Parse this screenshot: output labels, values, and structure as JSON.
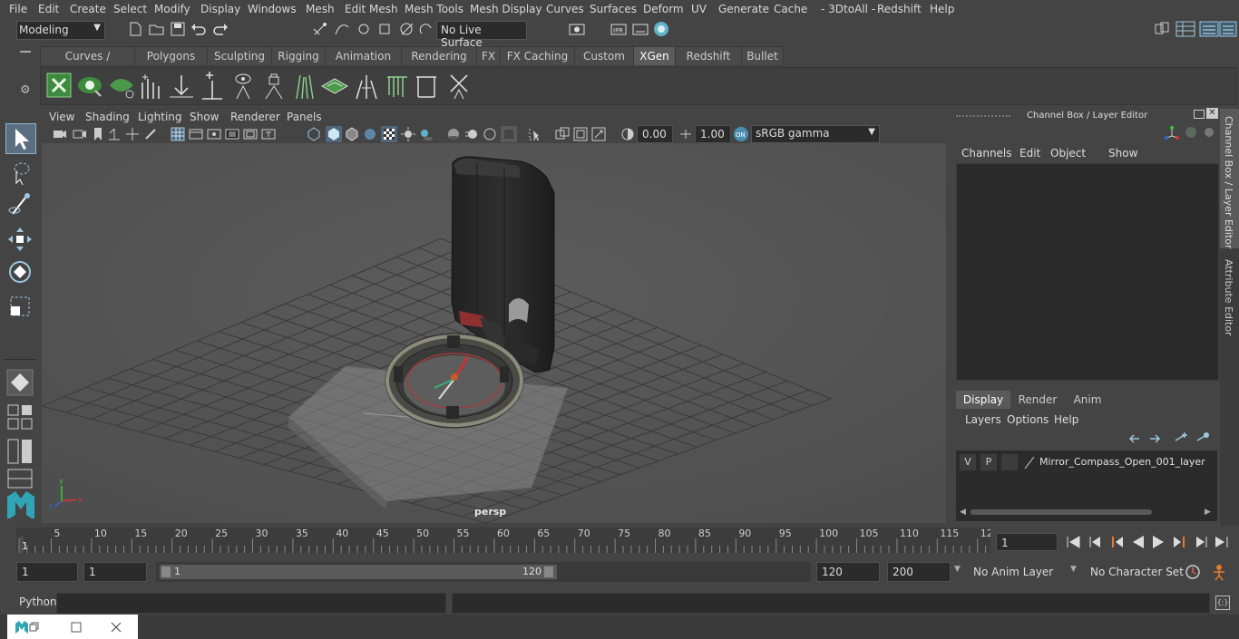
{
  "menu": [
    "File",
    "Edit",
    "Create",
    "Select",
    "Modify",
    "Display",
    "Windows",
    "Mesh",
    "Edit Mesh",
    "Mesh Tools",
    "Mesh Display",
    "Curves",
    "Surfaces",
    "Deform",
    "UV",
    "Generate",
    "Cache",
    "- 3DtoAll -",
    "Redshift",
    "Help"
  ],
  "status": {
    "mode": "Modeling",
    "live_surface": "No Live Surface"
  },
  "shelf_tabs": [
    "Curves / Surfaces",
    "Polygons",
    "Sculpting",
    "Rigging",
    "Animation",
    "Rendering",
    "FX",
    "FX Caching",
    "Custom",
    "XGen",
    "Redshift",
    "Bullet"
  ],
  "active_shelf": "XGen",
  "viewport": {
    "menu": [
      "View",
      "Shading",
      "Lighting",
      "Show",
      "Renderer",
      "Panels"
    ],
    "exposure": "0.00",
    "gamma": "1.00",
    "color_space": "sRGB gamma",
    "camera_label": "persp"
  },
  "channel_box": {
    "title": "Channel Box / Layer Editor",
    "menu": [
      "Channels",
      "Edit",
      "Object",
      "Show"
    ],
    "layer_tabs": [
      "Display",
      "Render",
      "Anim"
    ],
    "active_layer_tab": "Display",
    "layer_menu": [
      "Layers",
      "Options",
      "Help"
    ],
    "layer": {
      "v": "V",
      "p": "P",
      "name": "Mirror_Compass_Open_001_layer"
    }
  },
  "side_tabs": [
    "Channel Box / Layer Editor",
    "Attribute Editor"
  ],
  "timeline": {
    "ticks": [
      "5",
      "10",
      "15",
      "20",
      "25",
      "30",
      "35",
      "40",
      "45",
      "50",
      "55",
      "60",
      "65",
      "70",
      "75",
      "80",
      "85",
      "90",
      "95",
      "100",
      "105",
      "110",
      "115",
      "12"
    ],
    "start_label": "1",
    "current_frame": "1"
  },
  "range": {
    "start": "1",
    "current": "1",
    "slider_start": "1",
    "slider_end": "120",
    "end": "120",
    "max": "200",
    "anim_layer": "No Anim Layer",
    "character_set": "No Character Set"
  },
  "cmd": {
    "label": "Python"
  },
  "colors": {
    "accent": "#5fb4c9",
    "layer_bg": "#2b2b2b"
  }
}
